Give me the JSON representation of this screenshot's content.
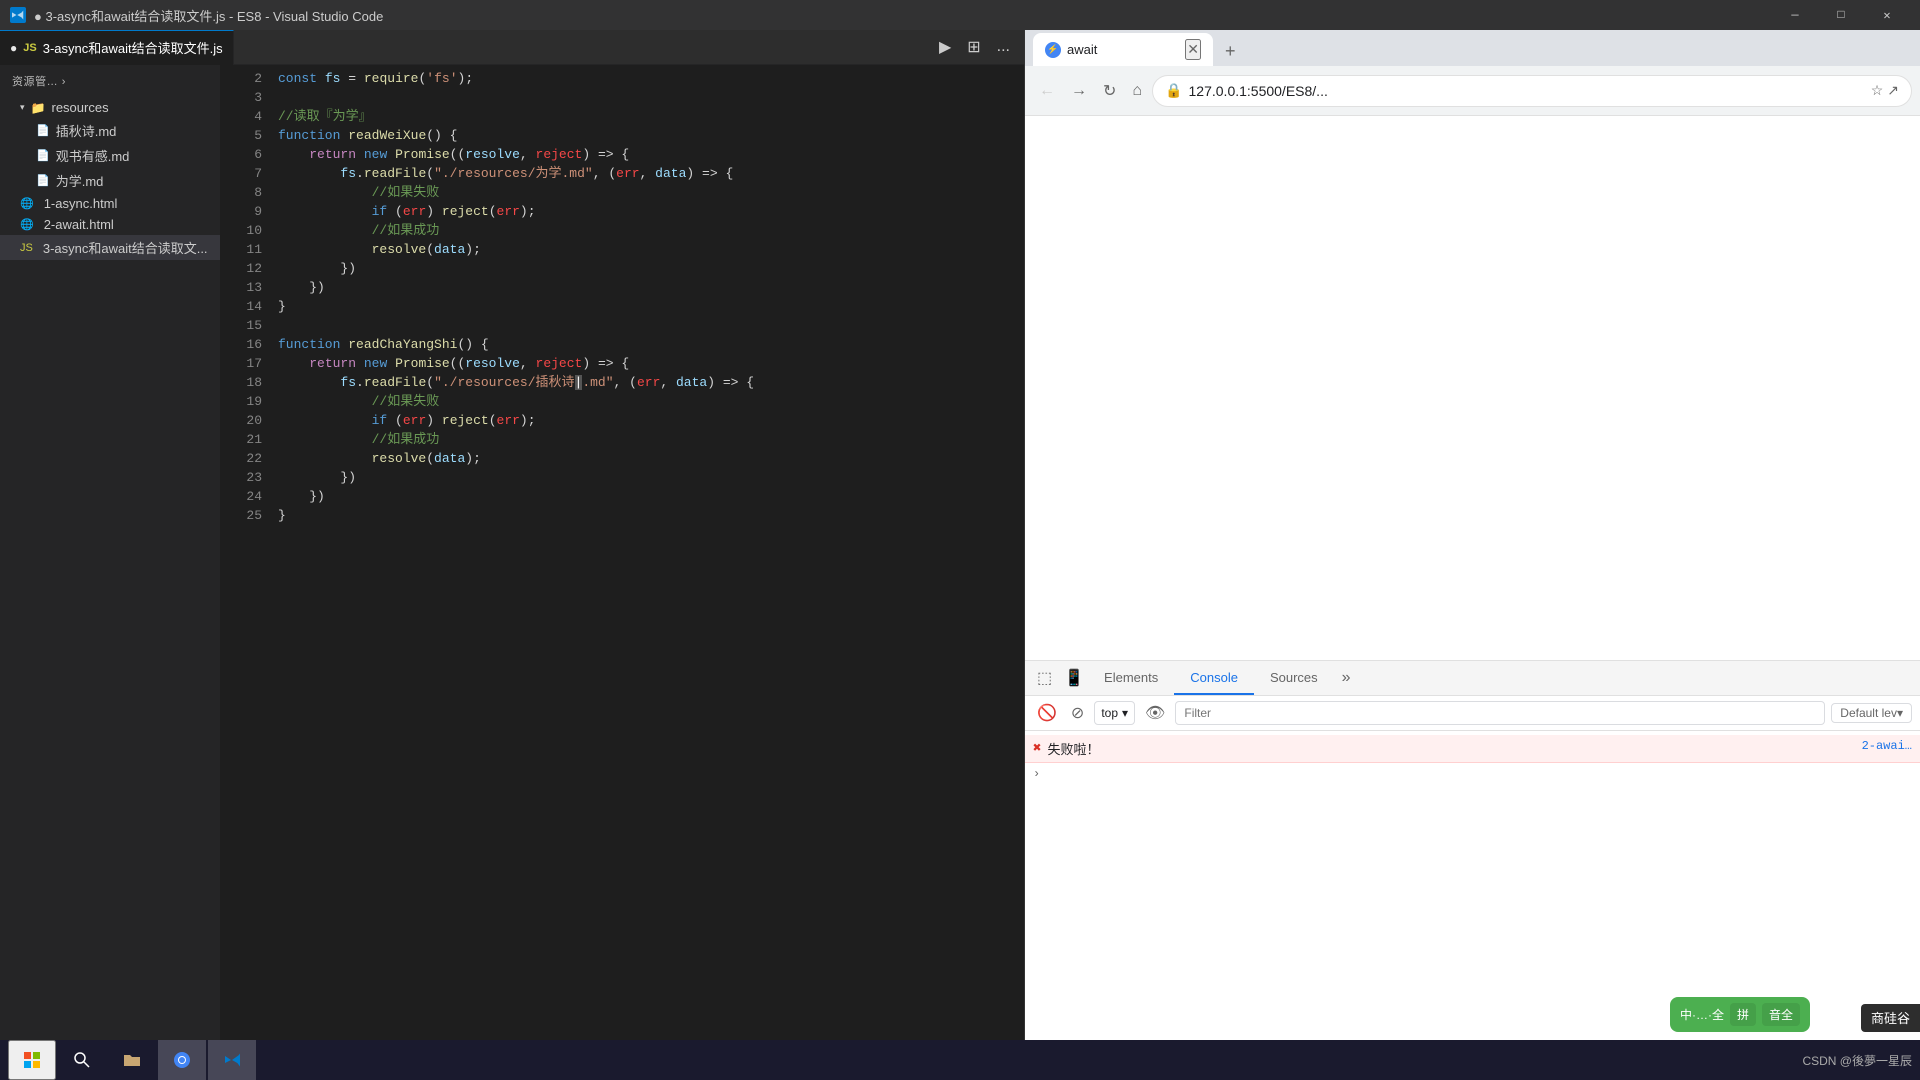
{
  "titleBar": {
    "title": "● 3-async和await结合读取文件.js - ES8 - Visual Studio Code",
    "icon": "VS",
    "minimizeLabel": "—",
    "maximizeLabel": "□",
    "closeLabel": "✕"
  },
  "vscode": {
    "tab": {
      "label": "3-async和await结合读取文件.js",
      "dot": "●",
      "runBtn": "▶",
      "splitBtn": "⊞",
      "moreBtn": "..."
    },
    "sidebar": {
      "header": "资源管… ›",
      "items": [
        {
          "label": "resources",
          "type": "folder",
          "expanded": true
        },
        {
          "label": "插秋诗.md",
          "type": "file-md",
          "indent": "file"
        },
        {
          "label": "观书有感.md",
          "type": "file-md",
          "indent": "file"
        },
        {
          "label": "为学.md",
          "type": "file-md",
          "indent": "file"
        },
        {
          "label": "1-async.html",
          "type": "file-html"
        },
        {
          "label": "2-await.html",
          "type": "file-html"
        },
        {
          "label": "3-async和await结合读取文...",
          "type": "file-js",
          "active": true
        }
      ]
    },
    "code": {
      "lines": [
        {
          "num": "2",
          "content": "const_fs_require"
        },
        {
          "num": "3",
          "content": ""
        },
        {
          "num": "4",
          "content": "comment_weixue"
        },
        {
          "num": "5",
          "content": "function_readWeiXue"
        },
        {
          "num": "6",
          "content": "return_new_promise"
        },
        {
          "num": "7",
          "content": "fs_readfile_weixue"
        },
        {
          "num": "8",
          "content": "comment_fail"
        },
        {
          "num": "9",
          "content": "if_reject"
        },
        {
          "num": "10",
          "content": "comment_success"
        },
        {
          "num": "11",
          "content": "resolve_data"
        },
        {
          "num": "12",
          "content": "close_1"
        },
        {
          "num": "13",
          "content": "close_2"
        },
        {
          "num": "14",
          "content": "close_3"
        },
        {
          "num": "15",
          "content": ""
        },
        {
          "num": "16",
          "content": "function_readChaYangShi"
        },
        {
          "num": "17",
          "content": "return_new_promise2"
        },
        {
          "num": "18",
          "content": "fs_readfile_chayang"
        },
        {
          "num": "19",
          "content": "comment_fail2"
        },
        {
          "num": "20",
          "content": "if_reject2"
        },
        {
          "num": "21",
          "content": "comment_success2"
        },
        {
          "num": "22",
          "content": "resolve_data2"
        },
        {
          "num": "23",
          "content": "close_4"
        },
        {
          "num": "24",
          "content": "close_5"
        },
        {
          "num": "25",
          "content": "close_6"
        }
      ]
    }
  },
  "browser": {
    "tab": {
      "favicon": "⚡",
      "label": "await",
      "closeBtn": "✕"
    },
    "newTabBtn": "+",
    "nav": {
      "backBtn": "←",
      "forwardBtn": "→",
      "refreshBtn": "↻",
      "homeBtn": "⌂"
    },
    "addressBar": {
      "url": "127.0.0.1:5500/ES8/...",
      "lockIcon": "🔒",
      "starIcon": "☆",
      "shareIcon": "↗"
    }
  },
  "devtools": {
    "tabs": [
      "Elements",
      "Console",
      "Sources"
    ],
    "activeTab": "Console",
    "consoleBar": {
      "clearBtn": "🚫",
      "stopBtn": "⊘",
      "context": "top",
      "eyeBtn": "👁",
      "filterPlaceholder": "Filter",
      "defaultLevel": "Default lev▾"
    },
    "consoleEntries": [
      {
        "type": "error",
        "text": "失败啦！",
        "source": "2-awai…"
      }
    ],
    "expandRow": {
      "arrow": "›"
    }
  },
  "taskbar": {
    "startBtn": "⊞",
    "apps": [
      {
        "icon": "🔍",
        "name": "search"
      },
      {
        "icon": "📁",
        "name": "file-explorer"
      },
      {
        "icon": "🌐",
        "name": "chrome"
      },
      {
        "icon": "💙",
        "name": "vscode"
      }
    ],
    "systemTray": {
      "text": "CSDN @後夢一星辰"
    }
  },
  "ime": {
    "label": "中·…·全",
    "btn1": "拼",
    "btn2": "音全",
    "brand": "商硅谷"
  }
}
